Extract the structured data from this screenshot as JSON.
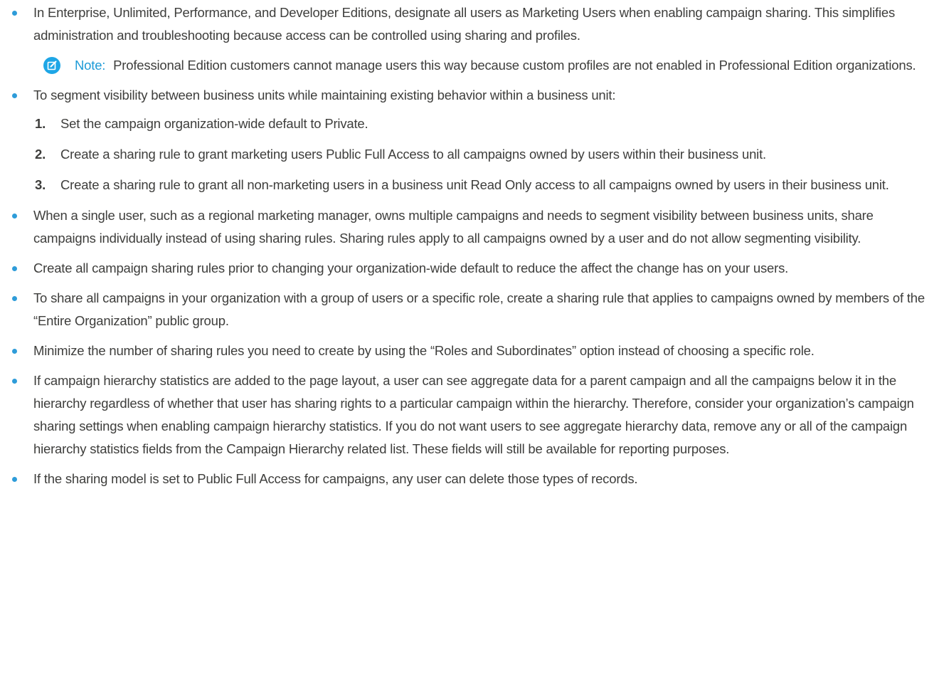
{
  "colors": {
    "text": "#3e3e3c",
    "bullet": "#2e9cd9",
    "note_accent": "#1e9bd7"
  },
  "bullets": [
    {
      "text": "In Enterprise, Unlimited, Performance, and Developer Editions, designate all users as Marketing Users when enabling campaign sharing. This simplifies administration and troubleshooting because access can be controlled using sharing and profiles.",
      "note": {
        "icon": "edit-note-icon",
        "label": "Note:",
        "text": "Professional Edition customers cannot manage users this way because custom profiles are not enabled in Professional Edition organizations."
      }
    },
    {
      "text": "To segment visibility between business units while maintaining existing behavior within a business unit:",
      "steps": [
        {
          "num": "1.",
          "text": "Set the campaign organization-wide default to Private."
        },
        {
          "num": "2.",
          "text": "Create a sharing rule to grant marketing users Public Full Access to all campaigns owned by users within their business unit."
        },
        {
          "num": "3.",
          "text": "Create a sharing rule to grant all non-marketing users in a business unit Read Only access to all campaigns owned by users in their business unit."
        }
      ]
    },
    {
      "text": "When a single user, such as a regional marketing manager, owns multiple campaigns and needs to segment visibility between business units, share campaigns individually instead of using sharing rules. Sharing rules apply to all campaigns owned by a user and do not allow segmenting visibility."
    },
    {
      "text": "Create all campaign sharing rules prior to changing your organization-wide default to reduce the affect the change has on your users."
    },
    {
      "text": "To share all campaigns in your organization with a group of users or a specific role, create a sharing rule that applies to campaigns owned by members of the “Entire Organization” public group."
    },
    {
      "text": "Minimize the number of sharing rules you need to create by using the “Roles and Subordinates” option instead of choosing a specific role."
    },
    {
      "text": "If campaign hierarchy statistics are added to the page layout, a user can see aggregate data for a parent campaign and all the campaigns below it in the hierarchy regardless of whether that user has sharing rights to a particular campaign within the hierarchy. Therefore, consider your organization’s campaign sharing settings when enabling campaign hierarchy statistics. If you do not want users to see aggregate hierarchy data, remove any or all of the campaign hierarchy statistics fields from the Campaign Hierarchy related list. These fields will still be available for reporting purposes."
    },
    {
      "text": "If the sharing model is set to Public Full Access for campaigns, any user can delete those types of records."
    }
  ]
}
